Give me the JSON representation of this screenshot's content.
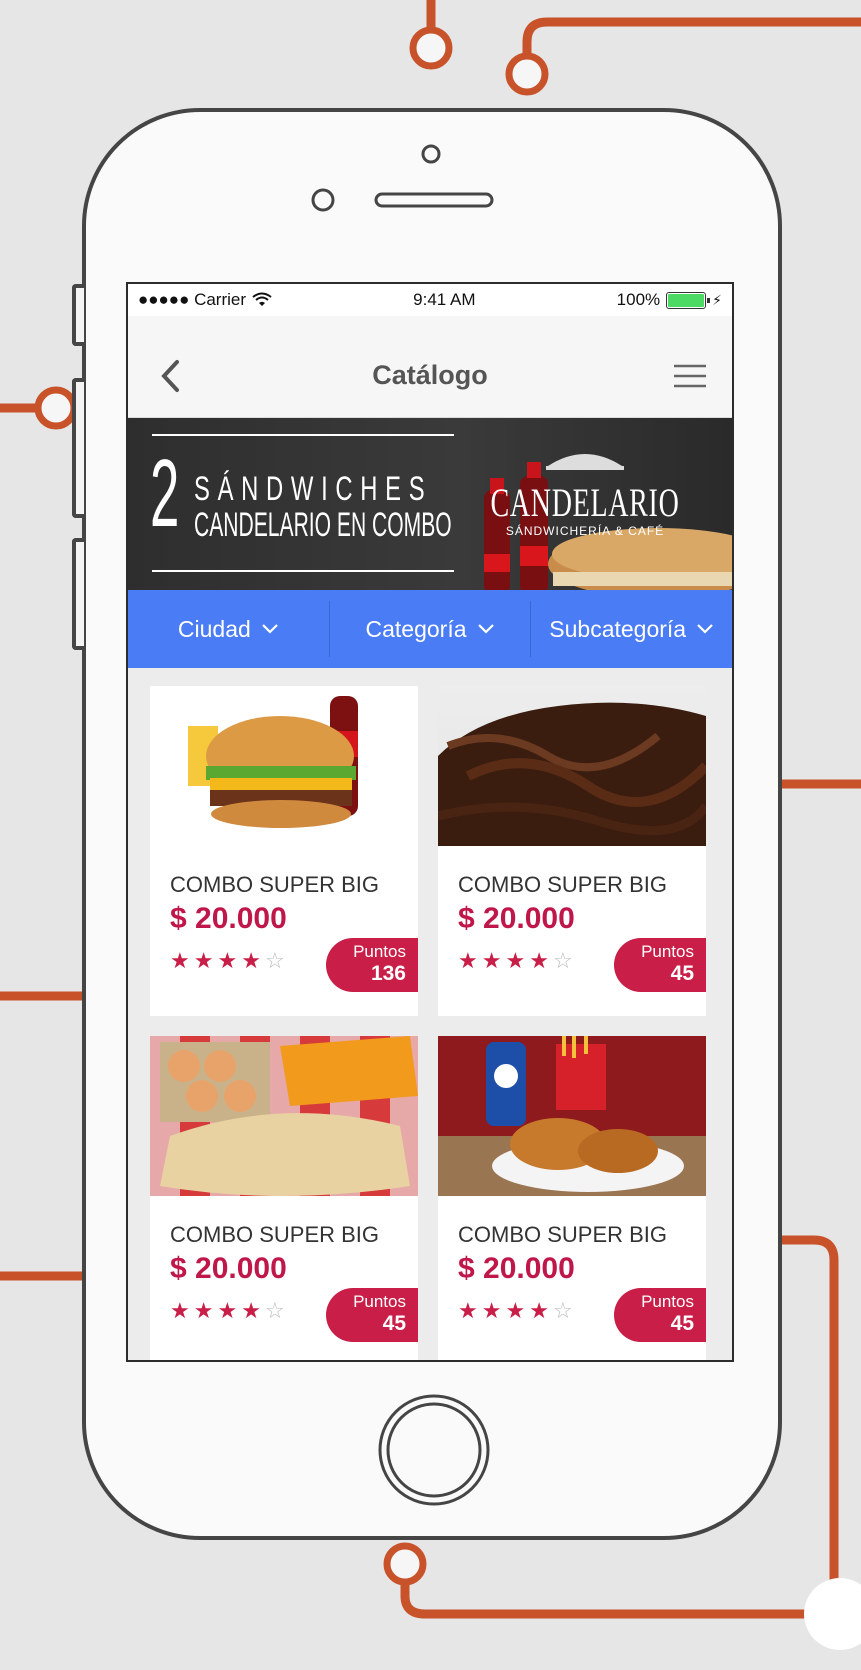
{
  "status_bar": {
    "carrier": "●●●●● Carrier",
    "time": "9:41 AM",
    "battery": "100%"
  },
  "nav": {
    "title": "Catálogo",
    "back_icon": "chevron-left-icon",
    "menu_icon": "hamburger-menu-icon"
  },
  "banner": {
    "number": "2",
    "line1": "SÁNDWICHES",
    "line2": "CANDELARIO EN COMBO",
    "brand": "CANDELARIO",
    "brand_tagline": "SÁNDWICHERÍA & CAFÉ"
  },
  "filters": [
    {
      "label": "Ciudad"
    },
    {
      "label": "Categoría"
    },
    {
      "label": "Subcategoría"
    }
  ],
  "products": [
    {
      "name": "COMBO SUPER BIG",
      "price": "$ 20.000",
      "rating": 4,
      "rating_max": 5,
      "points_label": "Puntos",
      "points": "136",
      "image": "burger-combo"
    },
    {
      "name": "COMBO SUPER BIG",
      "price": "$ 20.000",
      "rating": 4,
      "rating_max": 5,
      "points_label": "Puntos",
      "points": "45",
      "image": "chocolate-cake"
    },
    {
      "name": "COMBO SUPER BIG",
      "price": "$ 20.000",
      "rating": 4,
      "rating_max": 5,
      "points_label": "Puntos",
      "points": "45",
      "image": "groceries"
    },
    {
      "name": "COMBO SUPER BIG",
      "price": "$ 20.000",
      "rating": 4,
      "rating_max": 5,
      "points_label": "Puntos",
      "points": "45",
      "image": "fried-chicken"
    }
  ],
  "colors": {
    "accent_blue": "#4a7cf6",
    "brand_red": "#c81e47",
    "deco_orange": "#c8532b"
  }
}
